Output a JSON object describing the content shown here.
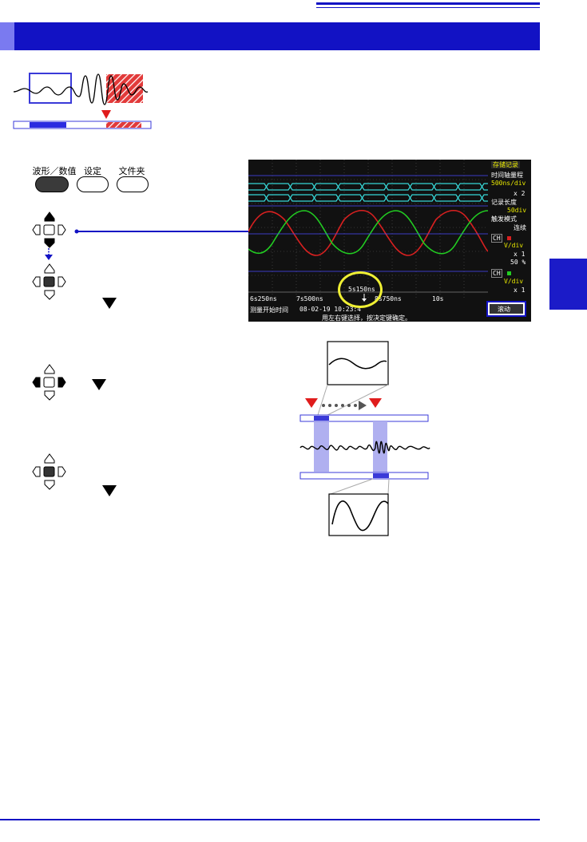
{
  "buttons": {
    "waveform_numeric": "波形／数值",
    "settings": "设定",
    "folder": "文件夹"
  },
  "screen": {
    "panel_title": "存储记录",
    "time_axis_label": "时间轴量程",
    "time_axis_value": "500ns/div",
    "zoom": "x 2",
    "record_length_label": "记录长度",
    "record_length_value": "50div",
    "trigger_mode_label": "触发模式",
    "trigger_mode_value": "连续",
    "ch_a": "CH",
    "ch_b": "CH",
    "ch_a_range": "V/div",
    "ch_a_mul": "x 1",
    "ch_a_pct": "50 %",
    "ch_b_range": "V/div",
    "ch_b_mul": "x 1",
    "time_labels": [
      "6s250ns",
      "7s500ns",
      "8s750ns",
      "10s"
    ],
    "cursor_time": "5s150ns",
    "start_time_label": "测量开始时间",
    "start_time_value": "08-02-19 10:23:4",
    "bottom_hint": "用左右键选择，按决定键确定。",
    "scroll_button": "滚动"
  },
  "colors": {
    "blue": "#1212c4",
    "red_marker": "#e02020",
    "cyan_trace": "#37d7d7",
    "red_trace": "#d82020",
    "green_trace": "#22cc22",
    "highlight": "#efef33"
  }
}
